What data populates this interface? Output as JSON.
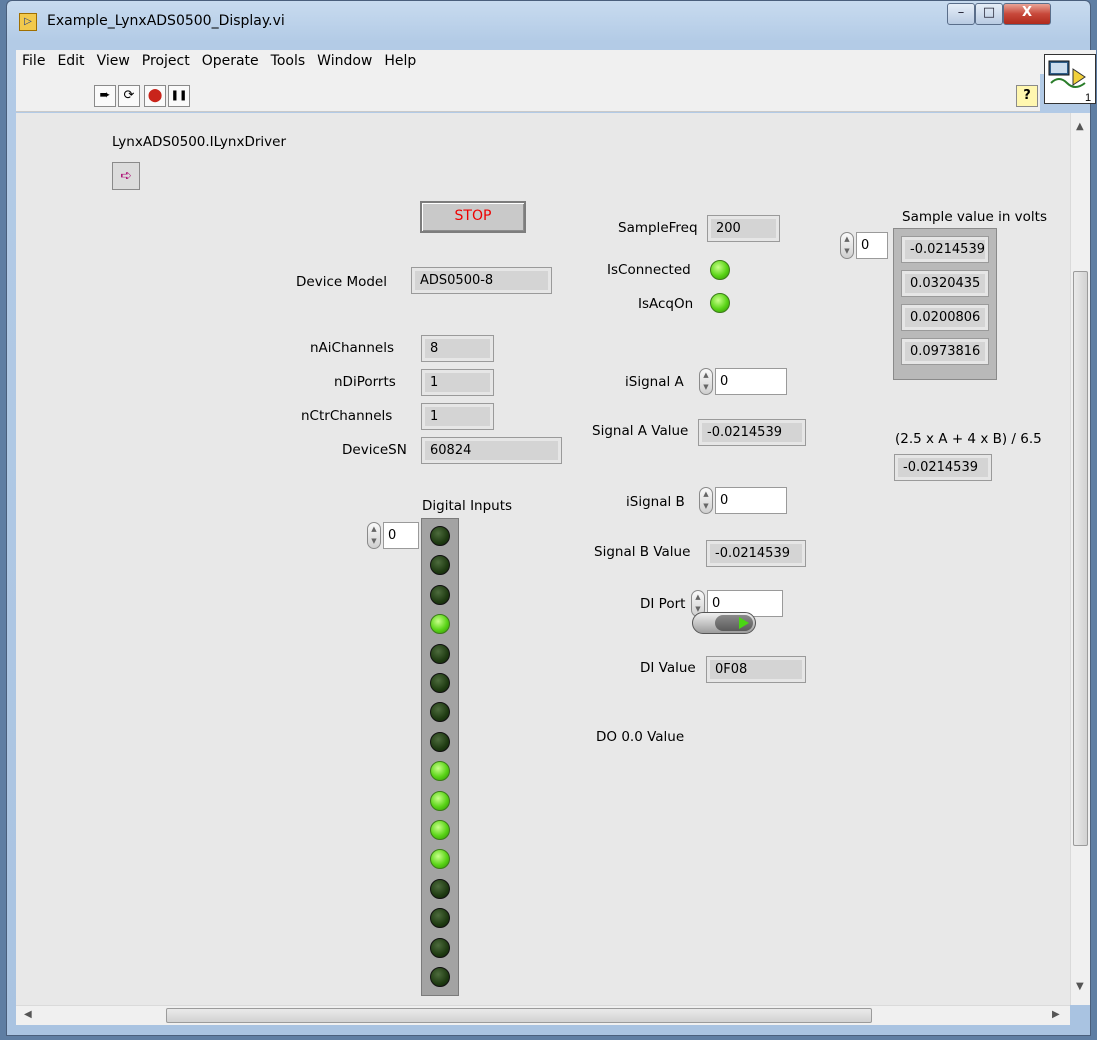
{
  "window": {
    "title": "Example_LynxADS0500_Display.vi",
    "app_icon": "labview-icon",
    "controls": {
      "minimize": "–",
      "maximize": "□",
      "close": "X"
    }
  },
  "menu": [
    "File",
    "Edit",
    "View",
    "Project",
    "Operate",
    "Tools",
    "Window",
    "Help"
  ],
  "toolbar": {
    "run_icon": "➨",
    "run_continuous_icon": "⟳",
    "abort_icon": "⬤",
    "pause_icon": "❚❚",
    "help_icon": "?"
  },
  "vi_icon": {
    "connector_index": "1"
  },
  "panel": {
    "driver_label": "LynxADS0500.ILynxDriver",
    "driver_icon": "➪",
    "stop_label": "STOP",
    "device_model_label": "Device Model",
    "device_model_value": "ADS0500-8",
    "n_ai_channels_label": "nAiChannels",
    "n_ai_channels_value": "8",
    "n_di_ports_label": "nDiPorrts",
    "n_di_ports_value": "1",
    "n_ctr_channels_label": "nCtrChannels",
    "n_ctr_channels_value": "1",
    "device_sn_label": "DeviceSN",
    "device_sn_value": "60824",
    "digital_inputs_label": "Digital Inputs",
    "digital_inputs_index": "0",
    "digital_inputs_states": [
      false,
      false,
      false,
      true,
      false,
      false,
      false,
      false,
      true,
      true,
      true,
      true,
      false,
      false,
      false,
      false
    ],
    "sample_freq_label": "SampleFreq",
    "sample_freq_value": "200",
    "is_connected_label": "IsConnected",
    "is_connected": true,
    "is_acq_on_label": "IsAcqOn",
    "is_acq_on": true,
    "isignal_a_label": "iSignal A",
    "isignal_a_value": "0",
    "signal_a_value_label": "Signal A Value",
    "signal_a_value": "-0.0214539",
    "isignal_b_label": "iSignal B",
    "isignal_b_value": "0",
    "signal_b_value_label": "Signal B Value",
    "signal_b_value": "-0.0214539",
    "di_port_label": "DI Port",
    "di_port_value": "0",
    "di_value_label": "DI Value",
    "di_value": "0F08",
    "do_label": "DO 0.0 Value",
    "do_state": true,
    "sample_values_label": "Sample value in volts",
    "sample_values_index": "0",
    "sample_values": [
      "-0.0214539",
      "0.0320435",
      "0.0200806",
      "0.0973816"
    ],
    "formula_label": "(2.5 x A + 4 x B) / 6.5",
    "formula_value": "-0.0214539"
  },
  "colors": {
    "led_on": "#5ad417",
    "led_off": "#1f3b12",
    "stop_text": "#e00000"
  }
}
